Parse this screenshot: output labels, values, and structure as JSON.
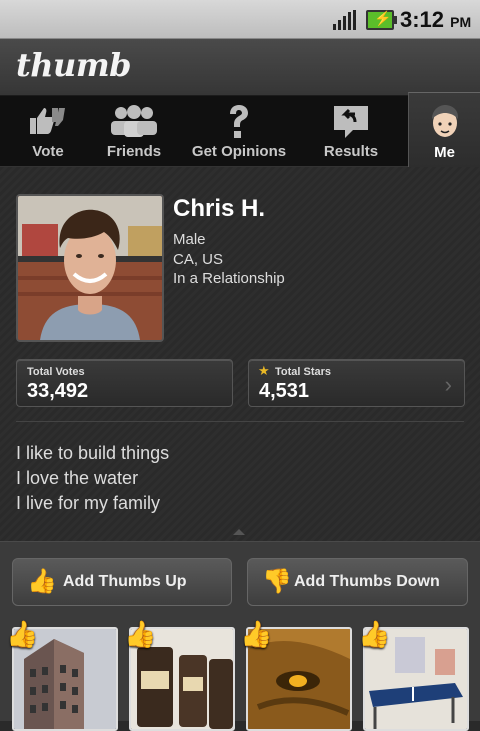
{
  "status": {
    "time": "3:12",
    "ampm": "PM"
  },
  "app": {
    "title": "thumb"
  },
  "tabs": [
    {
      "label": "Vote",
      "icon": "vote-icon"
    },
    {
      "label": "Friends",
      "icon": "friends-icon"
    },
    {
      "label": "Get Opinions",
      "icon": "question-icon"
    },
    {
      "label": "Results",
      "icon": "results-icon"
    },
    {
      "label": "Me",
      "icon": "me-icon",
      "active": true
    }
  ],
  "profile": {
    "name": "Chris H.",
    "gender": "Male",
    "location": "CA, US",
    "relationship": "In a Relationship"
  },
  "stats": {
    "votes_label": "Total Votes",
    "votes_value": "33,492",
    "stars_label": "Total Stars",
    "stars_value": "4,531"
  },
  "bio": [
    "I like to build things",
    "I love the water",
    "I live for my family"
  ],
  "actions": {
    "thumbs_up": "Add Thumbs Up",
    "thumbs_down": "Add Thumbs Down"
  },
  "colors": {
    "star": "#e9b826",
    "tab_active_bg": "#333333"
  }
}
